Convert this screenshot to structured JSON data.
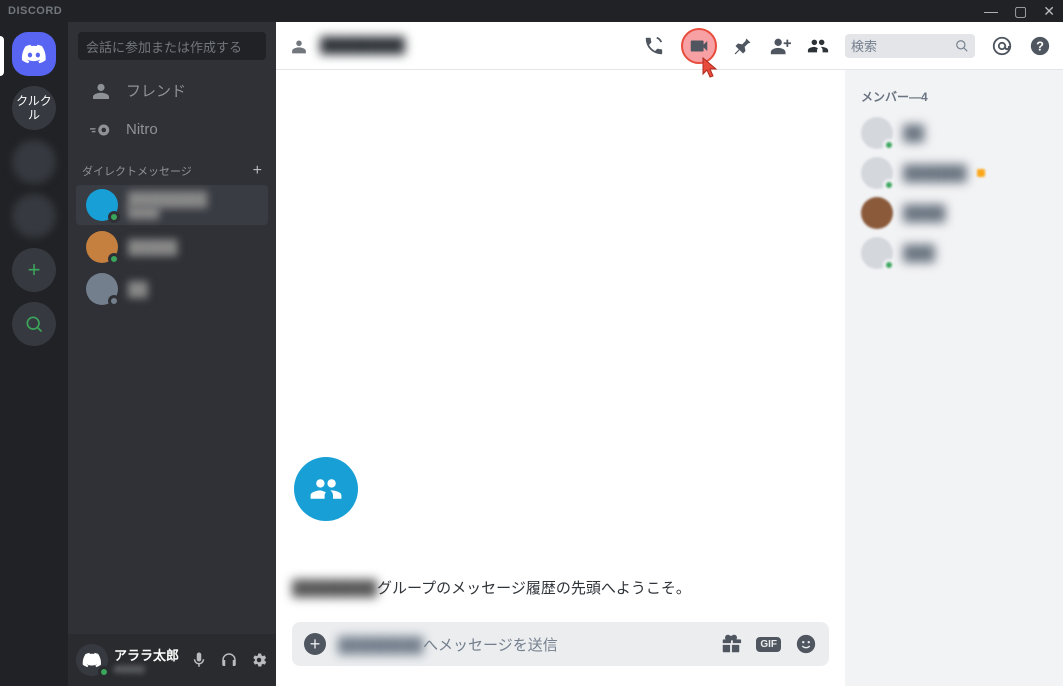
{
  "titlebar": {
    "logo": "DISCORD"
  },
  "server_rail": {
    "text_server": "クルクル"
  },
  "sidebar": {
    "search_placeholder": "会話に参加または作成する",
    "friends_label": "フレンド",
    "nitro_label": "Nitro",
    "dm_header": "ダイレクトメッセージ",
    "dm_items": [
      {
        "name": "████████",
        "sub": "████",
        "color": "#18a0d6",
        "status": "#3ba55c",
        "selected": true
      },
      {
        "name": "█████",
        "color": "#c57f3e",
        "status": "#3ba55c"
      },
      {
        "name": "██",
        "color": "#747f8d",
        "status": "#747f8d"
      }
    ]
  },
  "user_panel": {
    "name": "アララ太郎",
    "tag": "#0000"
  },
  "header": {
    "title": "████████",
    "search_placeholder": "検索"
  },
  "chat": {
    "welcome_prefix": "████████",
    "welcome_suffix": "グループのメッセージ履歴の先頭へようこそ。",
    "input_prefix": "████████",
    "input_suffix": "へメッセージを送信",
    "gif_label": "GIF"
  },
  "members": {
    "header_prefix": "メンバー—",
    "count": "4",
    "items": [
      {
        "name": "██",
        "color": "#d4d7dc",
        "status": "#3ba55c"
      },
      {
        "name": "██████",
        "color": "#d4d7dc",
        "status": "#3ba55c",
        "badge": "#faa61a"
      },
      {
        "name": "████",
        "color": "#8a5a3b",
        "status": "none"
      },
      {
        "name": "███",
        "color": "#d4d7dc",
        "status": "#3ba55c"
      }
    ]
  }
}
